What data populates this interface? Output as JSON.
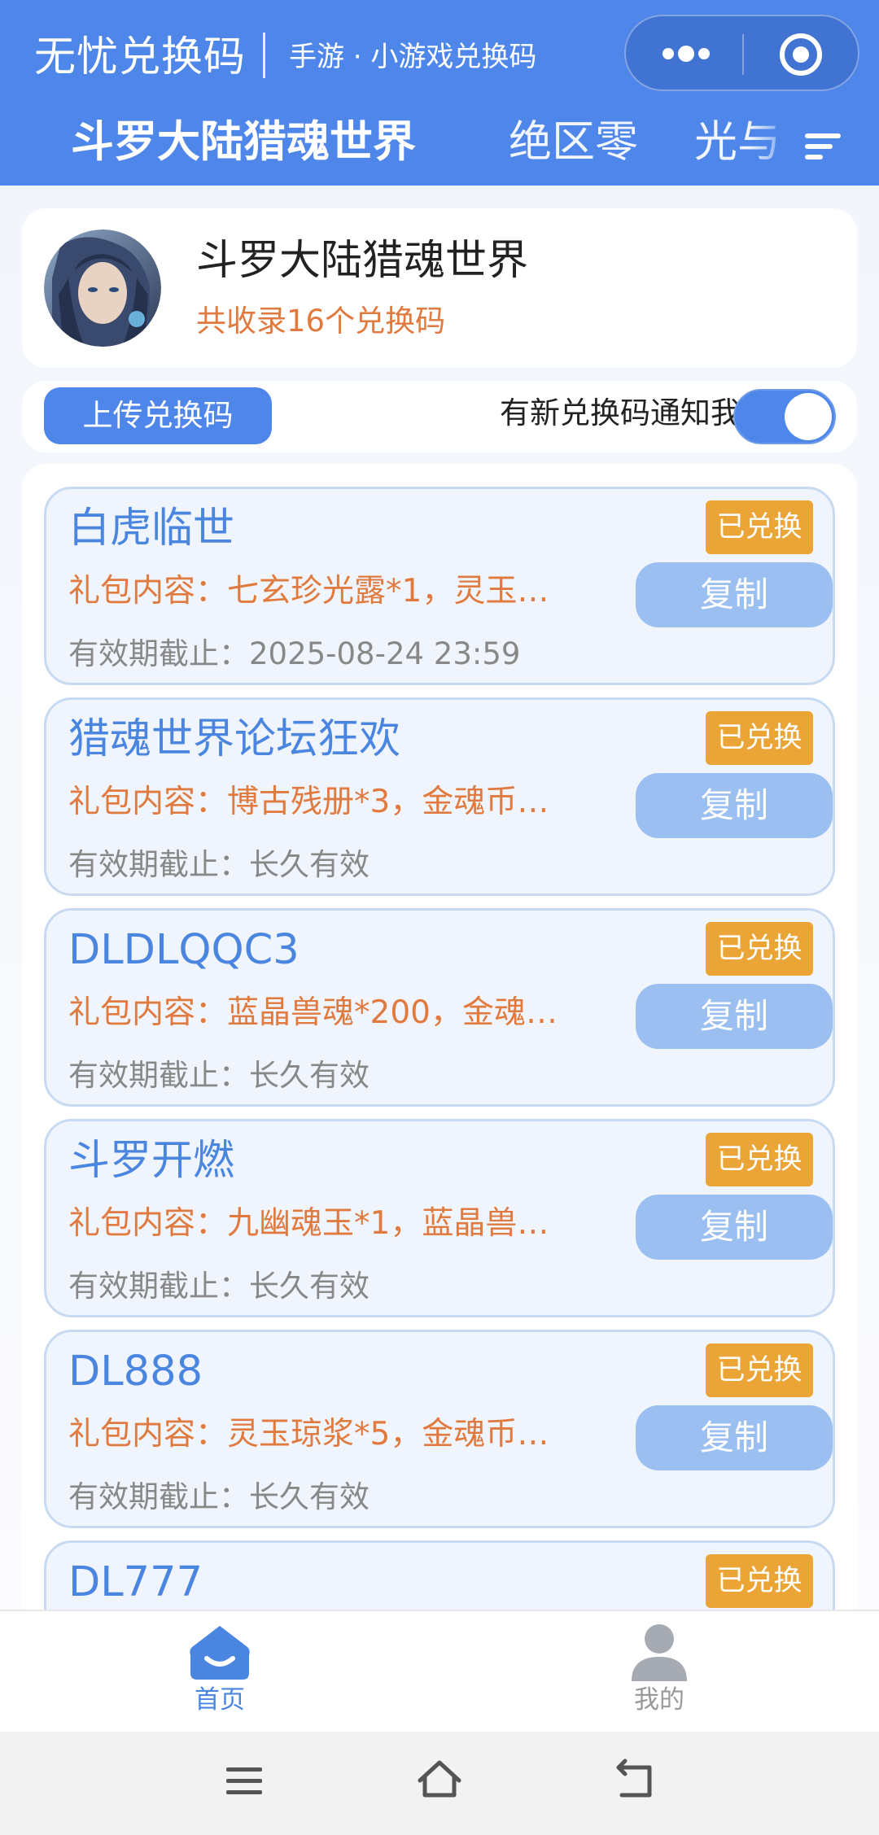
{
  "header": {
    "app_title": "无忧兑换码",
    "app_subtitle": "手游 · 小游戏兑换码",
    "more_icon": "more-dots-icon",
    "record_icon": "record-icon",
    "background_color": "#4f86ea",
    "tabs": [
      {
        "label": "斗罗大陆猎魂世界",
        "active": true
      },
      {
        "label": "绝区零",
        "active": false
      },
      {
        "label": "光与夜之恋",
        "active": false
      }
    ],
    "sort_icon": "sort-lines-icon"
  },
  "game": {
    "name": "斗罗大陆猎魂世界",
    "count_text": "共收录16个兑换码",
    "avatar_icon": "game-avatar"
  },
  "actions": {
    "upload_label": "上传兑换码",
    "notify_label": "有新兑换码通知我",
    "notify_enabled": true
  },
  "codes": [
    {
      "name": "白虎临世",
      "badge": "已兑换",
      "gift": "礼包内容：七玄珍光露*1，灵玉…",
      "copy": "复制",
      "expiry": "有效期截止：2025-08-24 23:59"
    },
    {
      "name": "猎魂世界论坛狂欢",
      "badge": "已兑换",
      "gift": "礼包内容：博古残册*3，金魂币…",
      "copy": "复制",
      "expiry": "有效期截止：长久有效"
    },
    {
      "name": "DLDLQQC3",
      "badge": "已兑换",
      "gift": "礼包内容：蓝晶兽魂*200，金魂…",
      "copy": "复制",
      "expiry": "有效期截止：长久有效"
    },
    {
      "name": "斗罗开燃",
      "badge": "已兑换",
      "gift": "礼包内容：九幽魂玉*1，蓝晶兽…",
      "copy": "复制",
      "expiry": "有效期截止：长久有效"
    },
    {
      "name": "DL888",
      "badge": "已兑换",
      "gift": "礼包内容：灵玉琼浆*5，金魂币…",
      "copy": "复制",
      "expiry": "有效期截止：长久有效"
    },
    {
      "name": "DL777",
      "badge": "已兑换",
      "gift": "",
      "copy": "",
      "expiry": ""
    }
  ],
  "bottom_nav": {
    "home_label": "首页",
    "home_icon": "home-icon",
    "mine_label": "我的",
    "mine_icon": "user-icon"
  },
  "system_nav": {
    "menu_icon": "menu-icon",
    "home_icon": "home-outline-icon",
    "back_icon": "back-icon"
  },
  "colors": {
    "accent": "#4f86ea",
    "code_title": "#4a86e0",
    "gift_text": "#e07a3f",
    "badge": "#eba536",
    "copy_button": "#9bbff0"
  }
}
